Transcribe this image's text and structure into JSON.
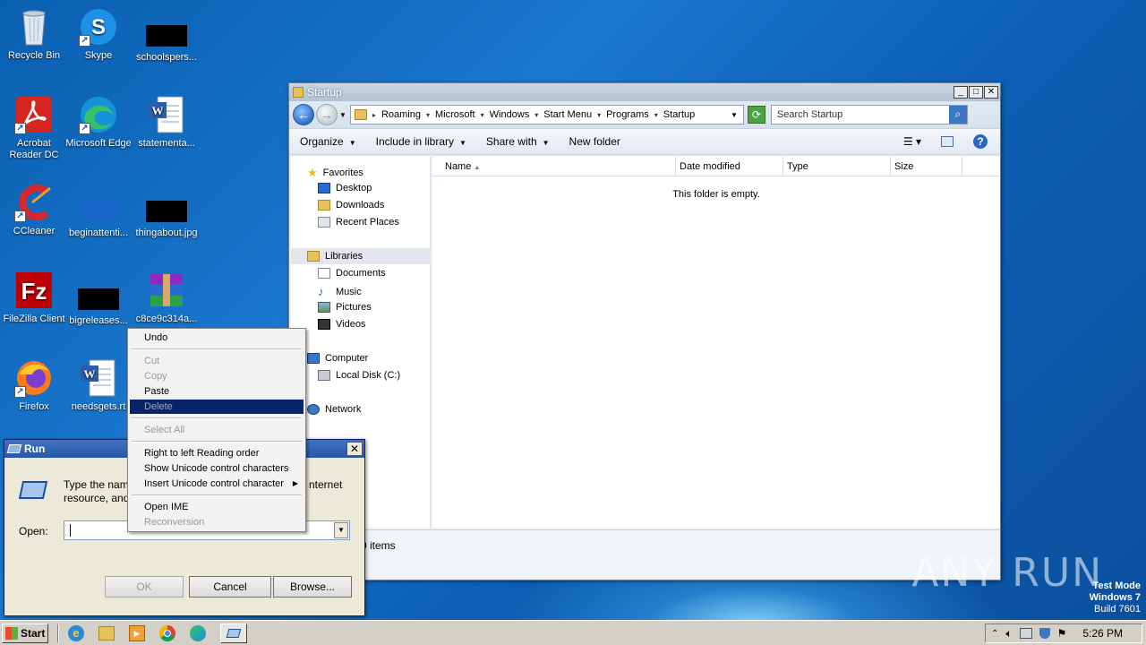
{
  "desktop": {
    "icons": [
      {
        "label": "Recycle Bin"
      },
      {
        "label": "Skype"
      },
      {
        "label": "schoolspers..."
      },
      {
        "label": "Acrobat Reader DC"
      },
      {
        "label": "Microsoft Edge"
      },
      {
        "label": "statementa..."
      },
      {
        "label": "CCleaner"
      },
      {
        "label": "beginattenti..."
      },
      {
        "label": "thingabout.jpg"
      },
      {
        "label": "FileZilla Client"
      },
      {
        "label": "bigreleases..."
      },
      {
        "label": "c8ce9c314a..."
      },
      {
        "label": "Firefox"
      },
      {
        "label": "needsgets.rt"
      }
    ]
  },
  "explorer": {
    "title": "Startup",
    "breadcrumbs": [
      "Roaming",
      "Microsoft",
      "Windows",
      "Start Menu",
      "Programs",
      "Startup"
    ],
    "search_placeholder": "Search Startup",
    "commands": [
      "Organize",
      "Include in library",
      "Share with",
      "New folder"
    ],
    "nav": {
      "favorites": "Favorites",
      "desktop": "Desktop",
      "downloads": "Downloads",
      "recent": "Recent Places",
      "libraries": "Libraries",
      "documents": "Documents",
      "music": "Music",
      "pictures": "Pictures",
      "videos": "Videos",
      "computer": "Computer",
      "local_disk": "Local Disk (C:)",
      "network": "Network"
    },
    "columns": [
      "Name",
      "Date modified",
      "Type",
      "Size"
    ],
    "empty_message": "This folder is empty.",
    "status": "0 items"
  },
  "run": {
    "title": "Run",
    "description_left": "Type the nam",
    "description_left2": "resource, and",
    "description_right": "nternet",
    "open_label": "Open:",
    "ok": "OK",
    "cancel": "Cancel",
    "browse": "Browse..."
  },
  "context_menu": {
    "undo": "Undo",
    "cut": "Cut",
    "copy": "Copy",
    "paste": "Paste",
    "delete": "Delete",
    "select_all": "Select All",
    "rtl": "Right to left Reading order",
    "show_unicode": "Show Unicode control characters",
    "insert_unicode": "Insert Unicode control character",
    "open_ime": "Open IME",
    "reconversion": "Reconversion"
  },
  "taskbar": {
    "start": "Start",
    "clock": "5:26 PM"
  },
  "watermark": {
    "brand": "ANY RUN",
    "line1": "Test Mode",
    "line2": "Windows 7",
    "line3": "Build 7601"
  },
  "colors": {
    "wallpaper": "#1a78cf",
    "selection": "#0a246a",
    "run_title": "#2a57a8"
  }
}
